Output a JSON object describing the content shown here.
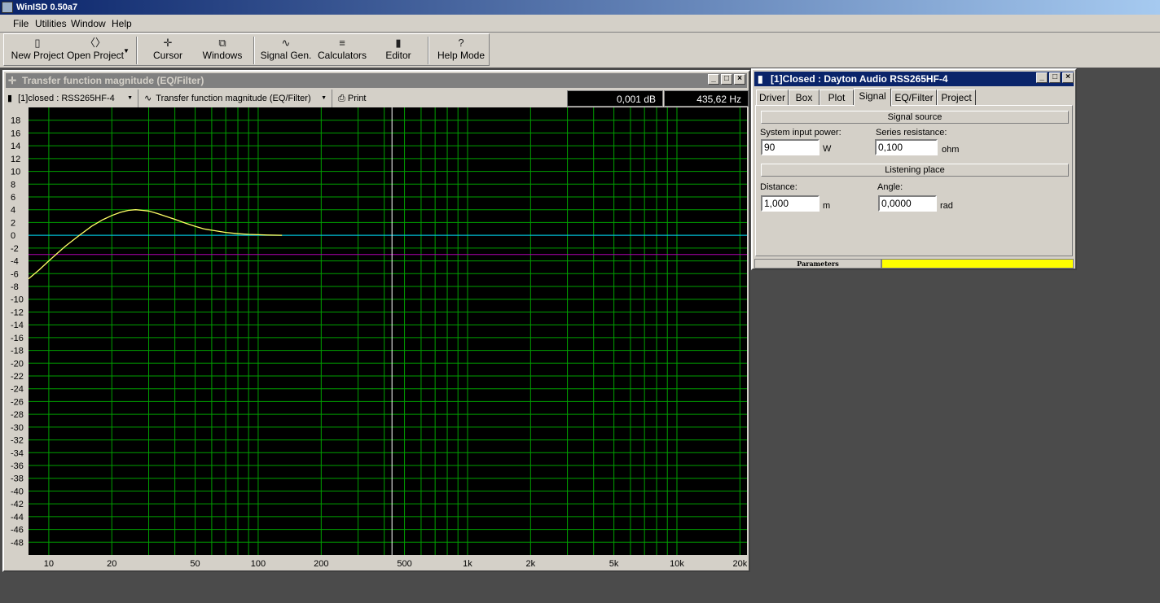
{
  "app": {
    "title": "WinISD 0.50a7"
  },
  "menu": [
    "File",
    "Utilities",
    "Window",
    "Help"
  ],
  "toolbar": {
    "new_project": "New Project",
    "open_project": "Open Project",
    "cursor": "Cursor",
    "windows": "Windows",
    "signal_gen": "Signal Gen.",
    "calculators": "Calculators",
    "editor": "Editor",
    "help_mode": "Help Mode"
  },
  "plot_window": {
    "title": "Transfer function magnitude (EQ/Filter)",
    "project_combo": "[1]closed : RSS265HF-4",
    "plot_combo": "Transfer function magnitude (EQ/Filter)",
    "print_label": "Print",
    "readout_db": "0,001 dB",
    "readout_hz": "435,62 Hz",
    "colors": {
      "background": "#000000",
      "grid": "#00a000",
      "curve": "#ffff66",
      "zero_line": "#00c8ff",
      "ref_line": "#b000b0",
      "cursor": "#ffffff"
    }
  },
  "chart_data": {
    "type": "line",
    "xscale": "log",
    "xlim": [
      8,
      22000
    ],
    "ylim": [
      -50,
      20
    ],
    "x_ticks": [
      10,
      20,
      50,
      100,
      200,
      500,
      1000,
      2000,
      5000,
      10000,
      20000
    ],
    "x_tick_labels": [
      "10",
      "20",
      "50",
      "100",
      "200",
      "500",
      "1k",
      "2k",
      "5k",
      "10k",
      "20k"
    ],
    "y_ticks": [
      18,
      16,
      14,
      12,
      10,
      8,
      6,
      4,
      2,
      0,
      -2,
      -4,
      -6,
      -8,
      -10,
      -12,
      -14,
      -16,
      -18,
      -20,
      -22,
      -24,
      -26,
      -28,
      -30,
      -32,
      -34,
      -36,
      -38,
      -40,
      -42,
      -44,
      -46,
      -48
    ],
    "grid": true,
    "series": [
      {
        "x": [
          8,
          9,
          10,
          11,
          12,
          14,
          16,
          18,
          20,
          22,
          24,
          26,
          28,
          30,
          33,
          36,
          40,
          45,
          50,
          55,
          60,
          70,
          80,
          90,
          100,
          110,
          130
        ],
        "y": [
          -6.8,
          -5.4,
          -4.0,
          -2.8,
          -1.7,
          0.0,
          1.4,
          2.4,
          3.1,
          3.6,
          3.9,
          4.0,
          3.9,
          3.8,
          3.4,
          3.0,
          2.5,
          1.9,
          1.4,
          1.0,
          0.8,
          0.45,
          0.25,
          0.15,
          0.1,
          0.05,
          0.0
        ]
      }
    ],
    "reference_lines": [
      {
        "y": 0
      },
      {
        "y": -3
      }
    ],
    "cursor_x": 435.62
  },
  "props_window": {
    "title": "[1]Closed : Dayton Audio RSS265HF-4",
    "tabs": [
      "Driver",
      "Box",
      "Plot",
      "Signal",
      "EQ/Filter",
      "Project"
    ],
    "active_tab": "Signal",
    "signal_source": "Signal source",
    "system_input_power_label": "System input power:",
    "system_input_power": "90",
    "power_unit": "W",
    "series_resistance_label": "Series resistance:",
    "series_resistance": "0,100",
    "resistance_unit": "ohm",
    "listening_place": "Listening place",
    "distance_label": "Distance:",
    "distance": "1,000",
    "distance_unit": "m",
    "angle_label": "Angle:",
    "angle": "0,0000",
    "angle_unit": "rad",
    "status_label": "Parameters",
    "status_color": "#ffff00"
  }
}
